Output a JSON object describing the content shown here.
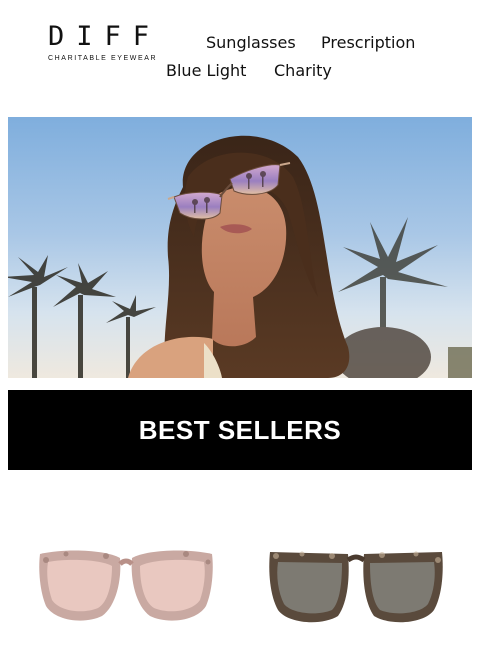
{
  "brand": {
    "name": "DIFF",
    "tagline": "CHARITABLE EYEWEAR"
  },
  "nav": {
    "items": [
      {
        "label": "Sunglasses"
      },
      {
        "label": "Prescription"
      },
      {
        "label": "Blue Light"
      },
      {
        "label": "Charity"
      }
    ]
  },
  "hero": {
    "image_icon": "woman-wearing-sunglasses-photo"
  },
  "section": {
    "title": "BEST SELLERS"
  },
  "products": [
    {
      "icon": "pink-tortoise-cat-eye-sunglasses",
      "frame_color": "#c9a9a2",
      "lens_color": "#e9c8c0"
    },
    {
      "icon": "tortoise-square-sunglasses",
      "frame_color": "#5a4a3c",
      "lens_color": "#7d7a72"
    }
  ]
}
